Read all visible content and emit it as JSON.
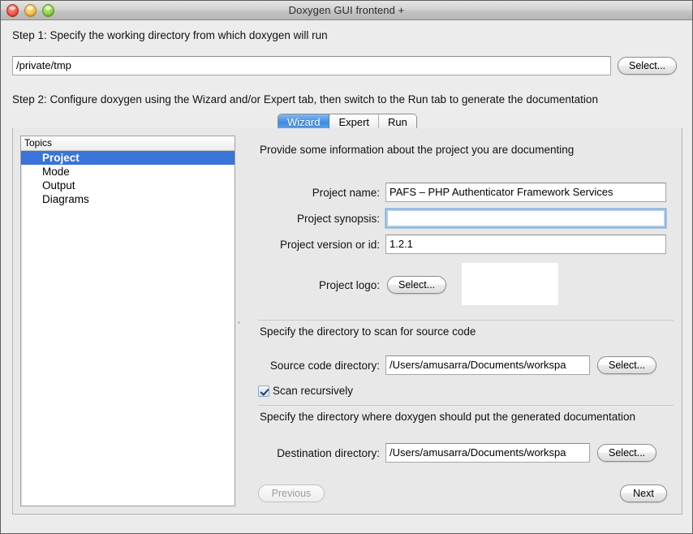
{
  "window": {
    "title": "Doxygen GUI frontend +",
    "traffic_lights": [
      "close-button",
      "minimize-button",
      "zoom-button"
    ]
  },
  "steps": {
    "step1": "Step 1: Specify the working directory from which doxygen will run",
    "step2": "Step 2: Configure doxygen using the Wizard and/or Expert tab, then switch to the Run tab to generate the documentation"
  },
  "working_directory": {
    "value": "/private/tmp",
    "placeholder": "",
    "select_label": "Select..."
  },
  "tabs": [
    {
      "label": "Wizard",
      "active": true
    },
    {
      "label": "Expert",
      "active": false
    },
    {
      "label": "Run",
      "active": false
    }
  ],
  "topics": {
    "header": "Topics",
    "items": [
      {
        "label": "Project",
        "selected": true
      },
      {
        "label": "Mode",
        "selected": false
      },
      {
        "label": "Output",
        "selected": false
      },
      {
        "label": "Diagrams",
        "selected": false
      }
    ]
  },
  "wizard": {
    "project_section_title": "Provide some information about the project you are documenting",
    "project_name": {
      "label": "Project name:",
      "value": "PAFS – PHP Authenticator Framework Services",
      "placeholder": ""
    },
    "project_synopsis": {
      "label": "Project synopsis:",
      "value": "",
      "placeholder": "",
      "focused": true
    },
    "project_version": {
      "label": "Project version or id:",
      "value": "1.2.1",
      "placeholder": ""
    },
    "project_logo": {
      "label": "Project logo:",
      "select_label": "Select...",
      "preview_value": ""
    },
    "source_section_title": "Specify the directory to scan for source code",
    "source_directory": {
      "label": "Source code directory:",
      "value": "/Users/amusarra/Documents/workspa",
      "placeholder": "",
      "select_label": "Select..."
    },
    "scan_recursively": {
      "label": "Scan recursively",
      "checked": true
    },
    "destination_section_title": "Specify the directory where doxygen should put the generated documentation",
    "destination_directory": {
      "label": "Destination directory:",
      "value": "/Users/amusarra/Documents/workspa",
      "placeholder": "",
      "select_label": "Select..."
    },
    "previous_button": {
      "label": "Previous",
      "disabled": true
    },
    "next_button": {
      "label": "Next",
      "disabled": false
    }
  },
  "colors": {
    "accent_blue": "#3a74d8",
    "tab_active_blue": "#4a94e8",
    "window_background": "#ececec",
    "panel_background": "#e8e8e8",
    "field_background": "#ffffff"
  }
}
